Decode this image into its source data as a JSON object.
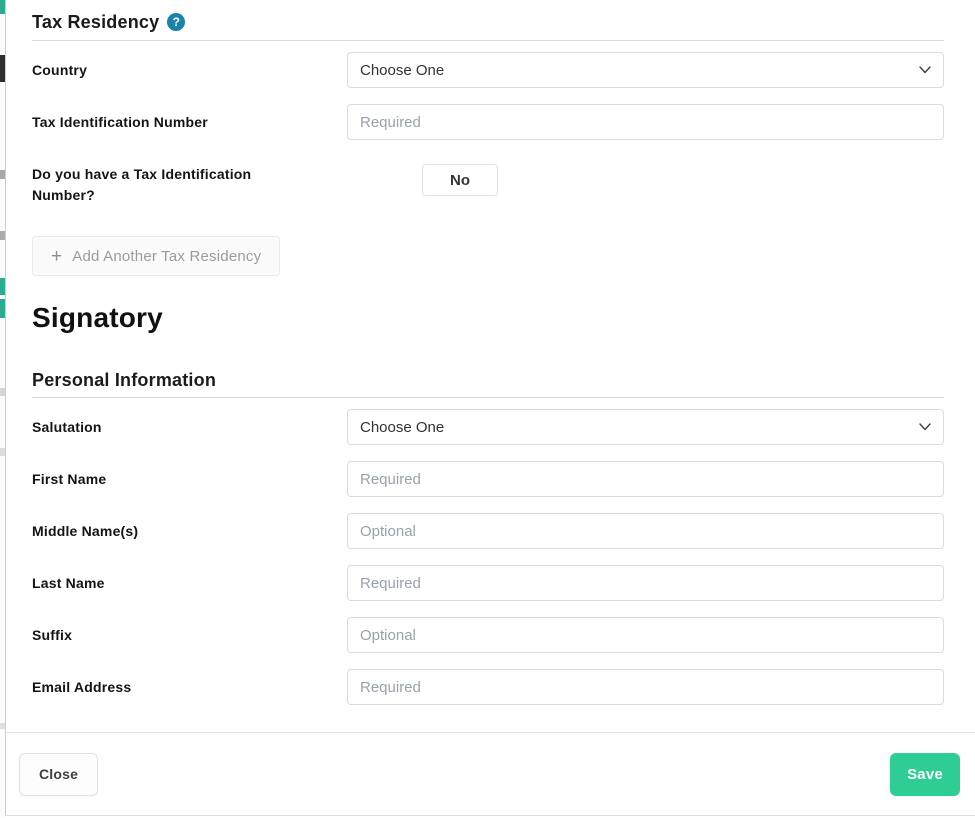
{
  "colors": {
    "accent_green": "#2ecd94",
    "help_blue": "#1b81ad",
    "edge_teal": "#2bab8f"
  },
  "icons": {
    "help": "?",
    "plus": "+",
    "chevron_down": "v"
  },
  "tax_residency": {
    "title": "Tax Residency",
    "rows": [
      {
        "label": "Country",
        "type": "select",
        "value": "Choose One"
      },
      {
        "label": "Tax Identification Number",
        "type": "input",
        "placeholder": "Required"
      },
      {
        "label": "Do you have a Tax Identification Number?",
        "type": "button",
        "button_label": "No"
      }
    ],
    "add_button_label": "Add Another Tax Residency"
  },
  "signatory": {
    "title": "Signatory"
  },
  "personal_information": {
    "title": "Personal Information",
    "rows": [
      {
        "label": "Salutation",
        "type": "select",
        "value": "Choose One"
      },
      {
        "label": "First Name",
        "type": "input",
        "placeholder": "Required"
      },
      {
        "label": "Middle Name(s)",
        "type": "input",
        "placeholder": "Optional"
      },
      {
        "label": "Last Name",
        "type": "input",
        "placeholder": "Required"
      },
      {
        "label": "Suffix",
        "type": "input",
        "placeholder": "Optional"
      },
      {
        "label": "Email Address",
        "type": "input",
        "placeholder": "Required"
      }
    ]
  },
  "footer": {
    "close_label": "Close",
    "save_label": "Save"
  }
}
